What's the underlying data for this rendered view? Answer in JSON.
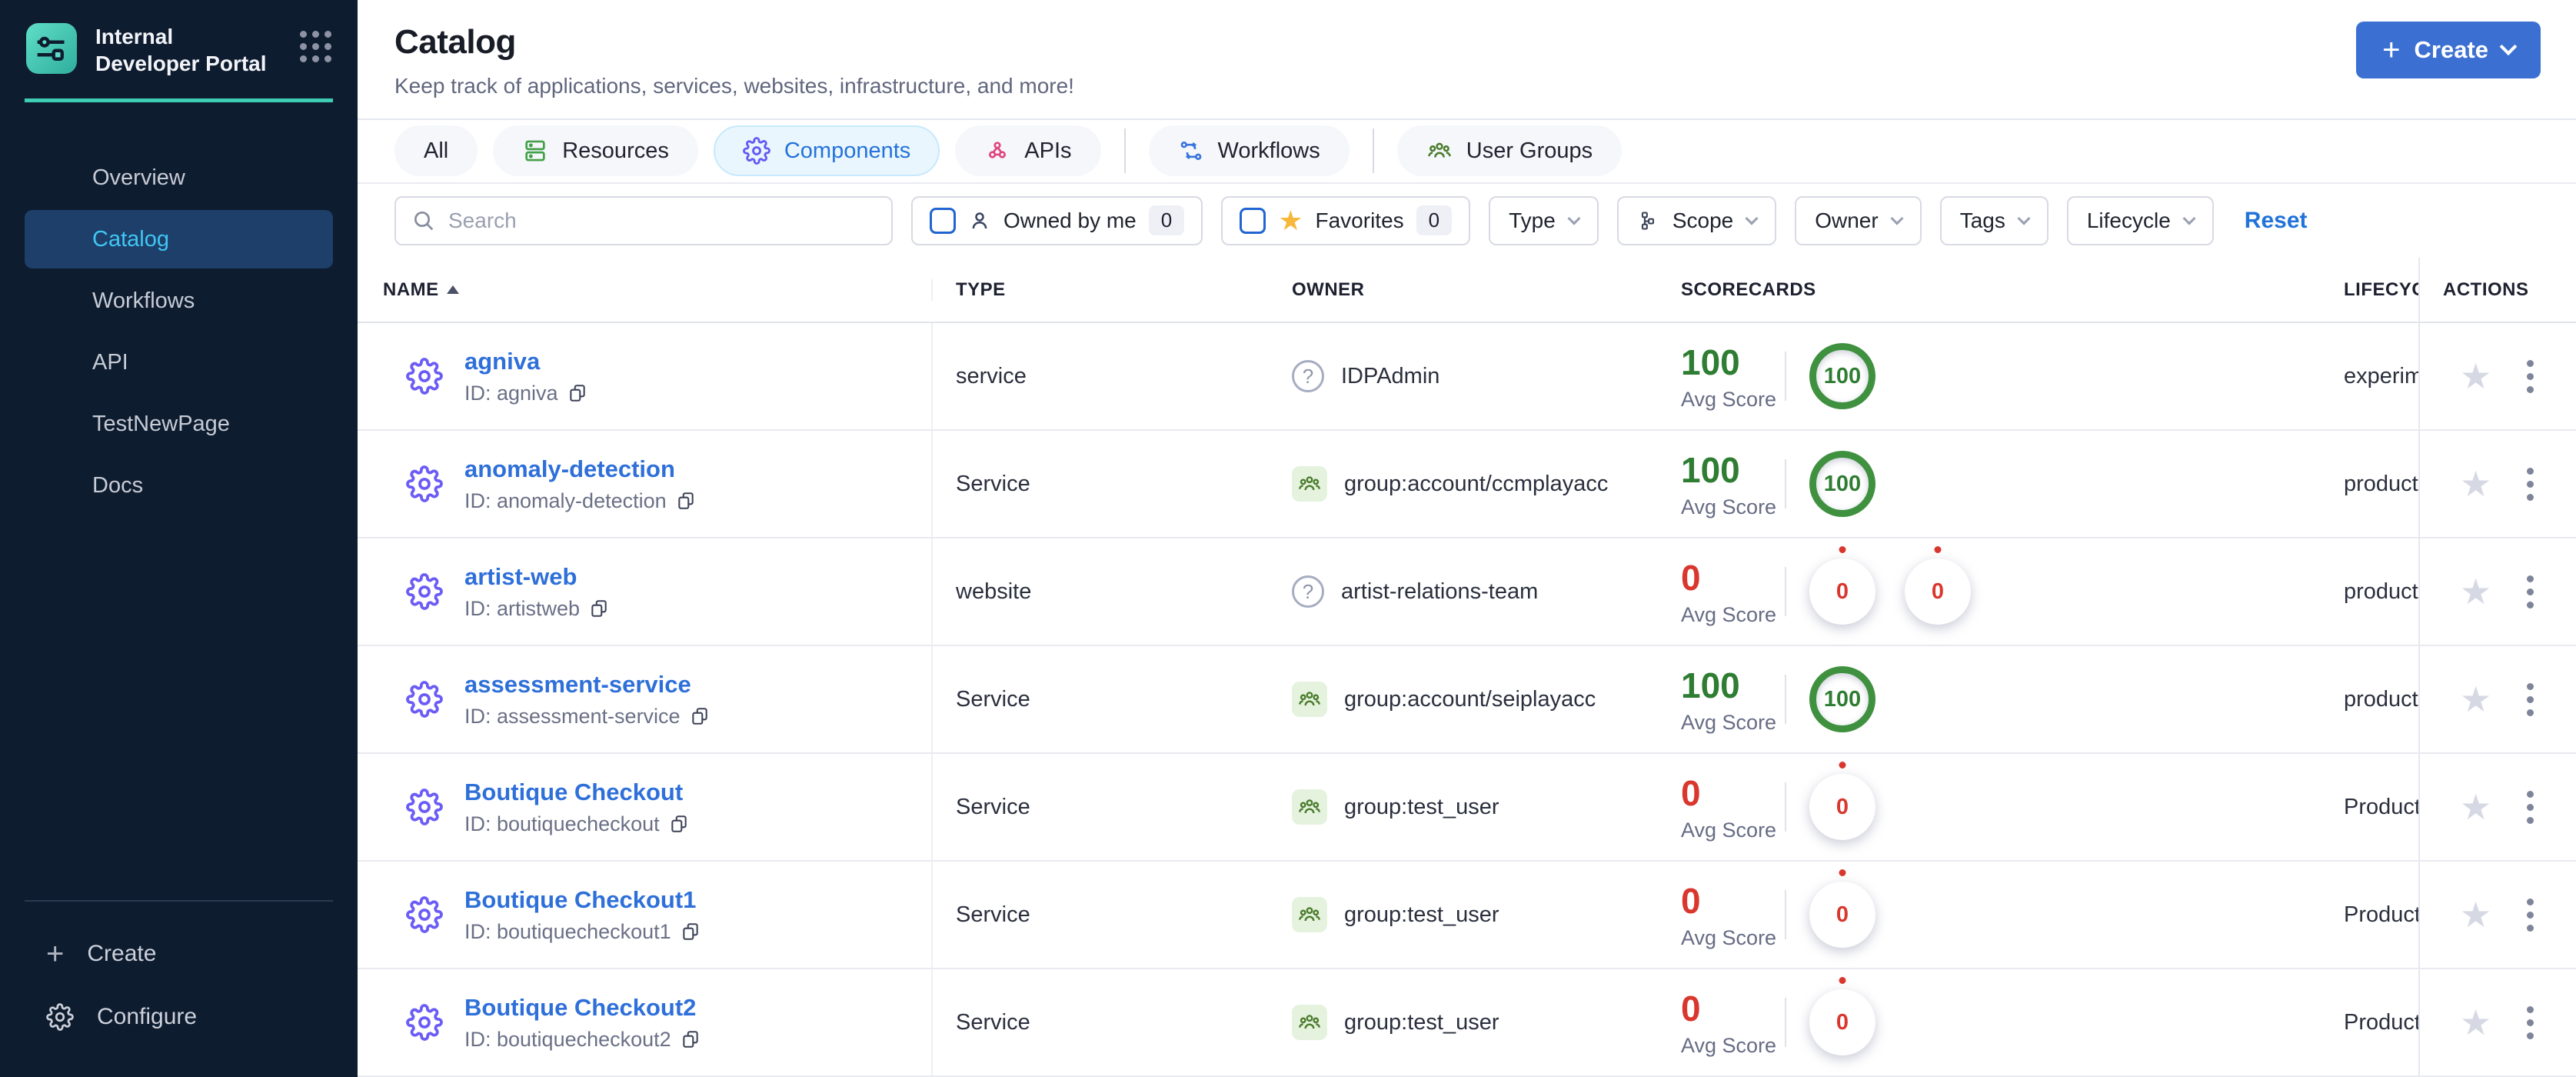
{
  "brand": {
    "title": "Internal Developer Portal"
  },
  "sidebar": {
    "items": [
      {
        "label": "Overview"
      },
      {
        "label": "Catalog",
        "active": true
      },
      {
        "label": "Workflows"
      },
      {
        "label": "API"
      },
      {
        "label": "TestNewPage"
      },
      {
        "label": "Docs"
      }
    ],
    "create_label": "Create",
    "configure_label": "Configure"
  },
  "header": {
    "title": "Catalog",
    "subtitle": "Keep track of applications, services, websites, infrastructure, and more!",
    "create_button": "Create"
  },
  "tabs": {
    "all": {
      "label": "All"
    },
    "resources": {
      "label": "Resources"
    },
    "components": {
      "label": "Components",
      "active": true
    },
    "apis": {
      "label": "APIs"
    },
    "workflows": {
      "label": "Workflows"
    },
    "user_groups": {
      "label": "User Groups"
    }
  },
  "filters": {
    "search_placeholder": "Search",
    "owned_by_me": {
      "label": "Owned by me",
      "count": "0"
    },
    "favorites": {
      "label": "Favorites",
      "count": "0"
    },
    "type_label": "Type",
    "scope_label": "Scope",
    "owner_label": "Owner",
    "tags_label": "Tags",
    "lifecycle_label": "Lifecycle",
    "reset_label": "Reset"
  },
  "table": {
    "columns": {
      "name": "NAME",
      "type": "TYPE",
      "owner": "OWNER",
      "scorecards": "SCORECARDS",
      "lifecycle": "LIFECYCLE",
      "actions": "ACTIONS"
    },
    "avg_score_label": "Avg Score",
    "rows": [
      {
        "name": "agniva",
        "id": "ID: agniva",
        "type": "service",
        "owner": "IDPAdmin",
        "owner_icon": "unknown",
        "score": "100",
        "score_variant": "green",
        "badges": [
          {
            "value": "100",
            "variant": "ring"
          }
        ],
        "lifecycle": "experimental"
      },
      {
        "name": "anomaly-detection",
        "id": "ID: anomaly-detection",
        "type": "Service",
        "owner": "group:account/ccmplayacc",
        "owner_icon": "group",
        "score": "100",
        "score_variant": "green",
        "badges": [
          {
            "value": "100",
            "variant": "ring"
          }
        ],
        "lifecycle": "production"
      },
      {
        "name": "artist-web",
        "id": "ID: artistweb",
        "type": "website",
        "owner": "artist-relations-team",
        "owner_icon": "unknown",
        "score": "0",
        "score_variant": "red",
        "badges": [
          {
            "value": "0",
            "variant": "zero"
          },
          {
            "value": "0",
            "variant": "zero"
          }
        ],
        "lifecycle": "production"
      },
      {
        "name": "assessment-service",
        "id": "ID: assessment-service",
        "type": "Service",
        "owner": "group:account/seiplayacc",
        "owner_icon": "group",
        "score": "100",
        "score_variant": "green",
        "badges": [
          {
            "value": "100",
            "variant": "ring"
          }
        ],
        "lifecycle": "production"
      },
      {
        "name": "Boutique Checkout",
        "id": "ID: boutiquecheckout",
        "type": "Service",
        "owner": "group:test_user",
        "owner_icon": "group",
        "score": "0",
        "score_variant": "red",
        "badges": [
          {
            "value": "0",
            "variant": "zero"
          }
        ],
        "lifecycle": "Production"
      },
      {
        "name": "Boutique Checkout1",
        "id": "ID: boutiquecheckout1",
        "type": "Service",
        "owner": "group:test_user",
        "owner_icon": "group",
        "score": "0",
        "score_variant": "red",
        "badges": [
          {
            "value": "0",
            "variant": "zero"
          }
        ],
        "lifecycle": "Production"
      },
      {
        "name": "Boutique Checkout2",
        "id": "ID: boutiquecheckout2",
        "type": "Service",
        "owner": "group:test_user",
        "owner_icon": "group",
        "score": "0",
        "score_variant": "red",
        "badges": [
          {
            "value": "0",
            "variant": "zero"
          }
        ],
        "lifecycle": "Production"
      }
    ]
  },
  "colors": {
    "sidebar_bg": "#0e1c30",
    "sidebar_active_bg": "#1d3f69",
    "sidebar_active_text": "#41c6f5",
    "accent_teal": "#3fceb5",
    "primary_blue": "#3b70d2",
    "link_blue": "#2e6fd9",
    "active_tab_bg": "#e9f6fe",
    "success_green": "#2e7d32",
    "error_red": "#d9372e",
    "favorite_yellow": "#f6b73c",
    "component_gear_purple": "#6658f5"
  }
}
